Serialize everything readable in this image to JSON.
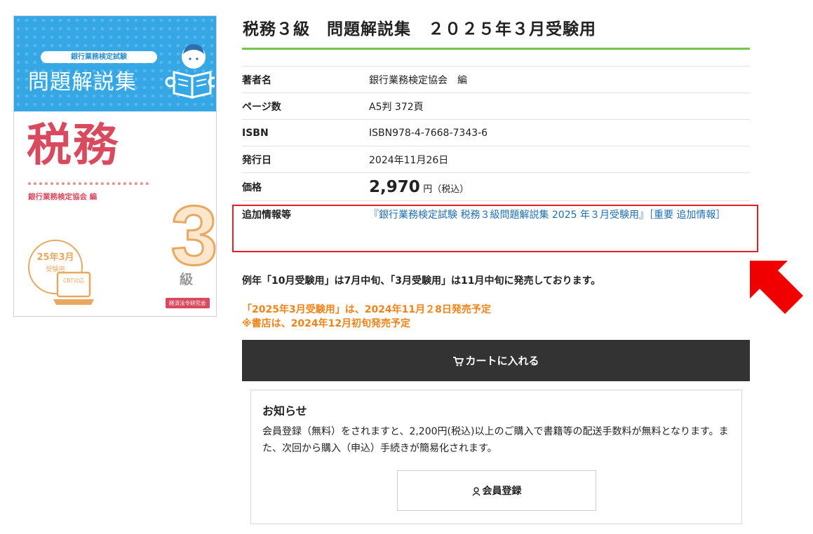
{
  "cover": {
    "series": "銀行業務検定試験",
    "kaisetsu": "問題解説集",
    "subject": "税務",
    "author": "銀行業務検定協会 編",
    "level_number": "3",
    "level_unit": "級",
    "badge_date": "25年3月",
    "badge_sub": "受験用",
    "laptop_label": "CBT対応",
    "publisher": "経済法令研究会"
  },
  "product": {
    "title": "税務３級　問題解説集　２０２５年３月受験用",
    "specs": {
      "author_label": "著者名",
      "author_value": "銀行業務検定協会　編",
      "pages_label": "ページ数",
      "pages_value": "A5判 372頁",
      "isbn_label": "ISBN",
      "isbn_value": "ISBN978-4-7668-7343-6",
      "date_label": "発行日",
      "date_value": "2024年11月26日",
      "price_label": "価格",
      "price_value": "2,970",
      "price_unit": "円（税込）",
      "extra_label": "追加情報等",
      "extra_link": "『銀行業務検定試験 税務３級問題解説集 2025 年３月受験用』［重要 追加情報］"
    }
  },
  "notices": {
    "plain": "例年「10月受験用」は7月中旬、「3月受験用」は11月中旬に発売しております。",
    "orange_line1": "「2025年3月受験用」は、2024年11月２8日発売予定",
    "orange_line2": "※書店は、2024年12月初旬発売予定"
  },
  "cart": {
    "label": "カートに入れる",
    "icon": "cart-icon"
  },
  "info_box": {
    "title": "お知らせ",
    "body": "会員登録（無料）をされますと、2,200円(税込)以上のご購入で書籍等の配送手数料が無料となります。また、次回から購入（申込）手続きが簡易化されます。",
    "button_label": "会員登録",
    "button_icon": "user-icon"
  },
  "colors": {
    "accent_green": "#77c44a",
    "highlight_red": "#e01f26",
    "notice_orange": "#f08318",
    "cart_bg": "#333333",
    "cover_blue": "#35a7e4",
    "cover_pink": "#d94a5e",
    "cover_orange": "#e9a860"
  }
}
